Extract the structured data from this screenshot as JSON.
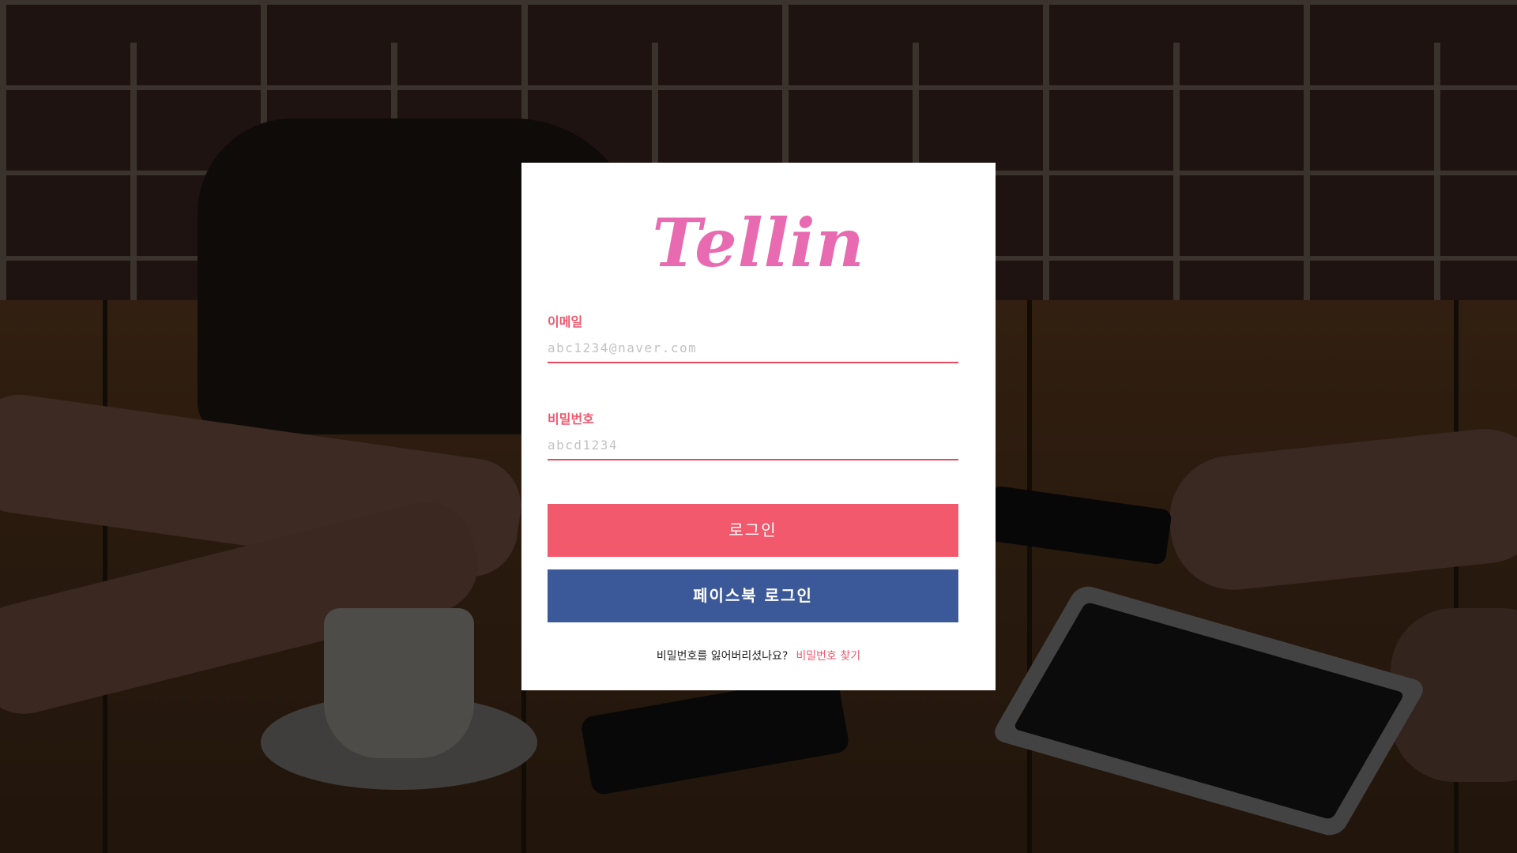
{
  "brand": {
    "logo_text": "Tellin",
    "logo_color": "#e86ab0"
  },
  "form": {
    "email_label": "이메일",
    "email_placeholder": "abc1234@naver.com",
    "email_value": "",
    "password_label": "비밀번호",
    "password_placeholder": "abcd1234",
    "password_value": ""
  },
  "buttons": {
    "login_label": "로그인",
    "facebook_login_label": "페이스북 로그인"
  },
  "footer": {
    "forgot_text": "비밀번호를 잃어버리셨나요?",
    "find_password_link": "비밀번호 찾기"
  },
  "colors": {
    "accent": "#f2596d",
    "facebook": "#3b5998",
    "card_background": "#ffffff"
  }
}
